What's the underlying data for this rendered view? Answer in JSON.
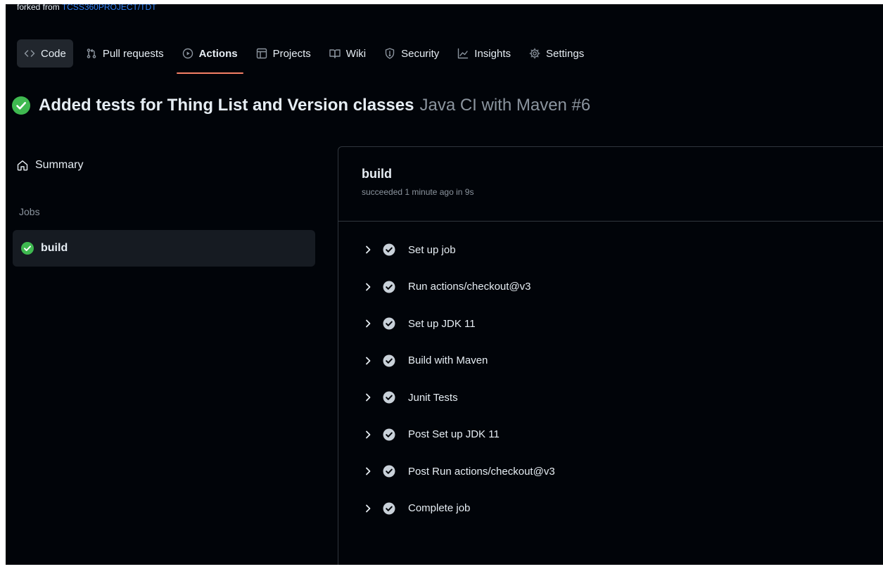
{
  "repo": {
    "forked_prefix": "forked from",
    "forked_link": "TCSS360PROJECT/TDT"
  },
  "tabs": [
    {
      "label": "Code",
      "icon": "code-icon"
    },
    {
      "label": "Pull requests",
      "icon": "pull-request-icon"
    },
    {
      "label": "Actions",
      "icon": "play-icon",
      "active": true
    },
    {
      "label": "Projects",
      "icon": "table-icon"
    },
    {
      "label": "Wiki",
      "icon": "book-icon"
    },
    {
      "label": "Security",
      "icon": "shield-icon"
    },
    {
      "label": "Insights",
      "icon": "graph-icon"
    },
    {
      "label": "Settings",
      "icon": "gear-icon"
    }
  ],
  "run": {
    "commit_title": "Added tests for Thing List and Version classes",
    "workflow": "Java CI with Maven #6",
    "status": "success"
  },
  "sidebar": {
    "summary_label": "Summary",
    "jobs_label": "Jobs",
    "jobs": [
      {
        "label": "build",
        "status": "success"
      }
    ]
  },
  "job": {
    "name": "build",
    "status_text": "succeeded 1 minute ago in 9s",
    "steps": [
      {
        "label": "Set up job"
      },
      {
        "label": "Run actions/checkout@v3"
      },
      {
        "label": "Set up JDK 11"
      },
      {
        "label": "Build with Maven"
      },
      {
        "label": "Junit Tests"
      },
      {
        "label": "Post Set up JDK 11"
      },
      {
        "label": "Post Run actions/checkout@v3"
      },
      {
        "label": "Complete job"
      }
    ]
  },
  "colors": {
    "success": "#3fb950",
    "accent_underline": "#f78166",
    "link": "#2f81f7",
    "background": "#010409"
  }
}
